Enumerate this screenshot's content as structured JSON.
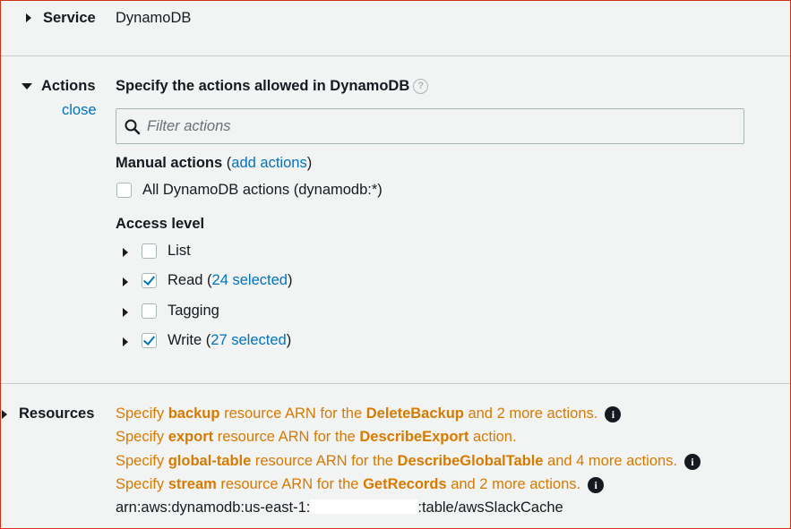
{
  "service": {
    "label": "Service",
    "value": "DynamoDB"
  },
  "actions": {
    "label": "Actions",
    "close_link": "close",
    "heading": "Specify the actions allowed in DynamoDB",
    "help_icon_glyph": "?",
    "filter_placeholder": "Filter actions",
    "manual_label": "Manual actions",
    "manual_open": "(",
    "add_actions_link": "add actions",
    "manual_close": ")",
    "all_actions_label": "All DynamoDB actions (dynamodb:*)",
    "access_level_label": "Access level",
    "levels": [
      {
        "name": "List",
        "checked": false,
        "selected_text": ""
      },
      {
        "name": "Read",
        "checked": true,
        "selected_text": "24 selected"
      },
      {
        "name": "Tagging",
        "checked": false,
        "selected_text": ""
      },
      {
        "name": "Write",
        "checked": true,
        "selected_text": "27 selected"
      }
    ]
  },
  "resources": {
    "label": "Resources",
    "warnings": [
      {
        "pre": "Specify ",
        "resource": "backup",
        "mid": " resource ARN for the ",
        "action": "DeleteBackup",
        "post": " and 2 more actions.",
        "info": true
      },
      {
        "pre": "Specify ",
        "resource": "export",
        "mid": " resource ARN for the ",
        "action": "DescribeExport",
        "post": " action.",
        "info": false
      },
      {
        "pre": "Specify ",
        "resource": "global-table",
        "mid": " resource ARN for the ",
        "action": "DescribeGlobalTable",
        "post": " and 4 more actions.",
        "info": true
      },
      {
        "pre": "Specify ",
        "resource": "stream",
        "mid": " resource ARN for the ",
        "action": "GetRecords",
        "post": " and 2 more actions.",
        "info": true
      }
    ],
    "arn_prefix": "arn:aws:dynamodb:us-east-1:",
    "arn_suffix": ":table/awsSlackCache",
    "info_glyph": "i"
  },
  "colors": {
    "link": "#0073bb",
    "warning": "#d77a00",
    "frame_border": "#d13212"
  }
}
